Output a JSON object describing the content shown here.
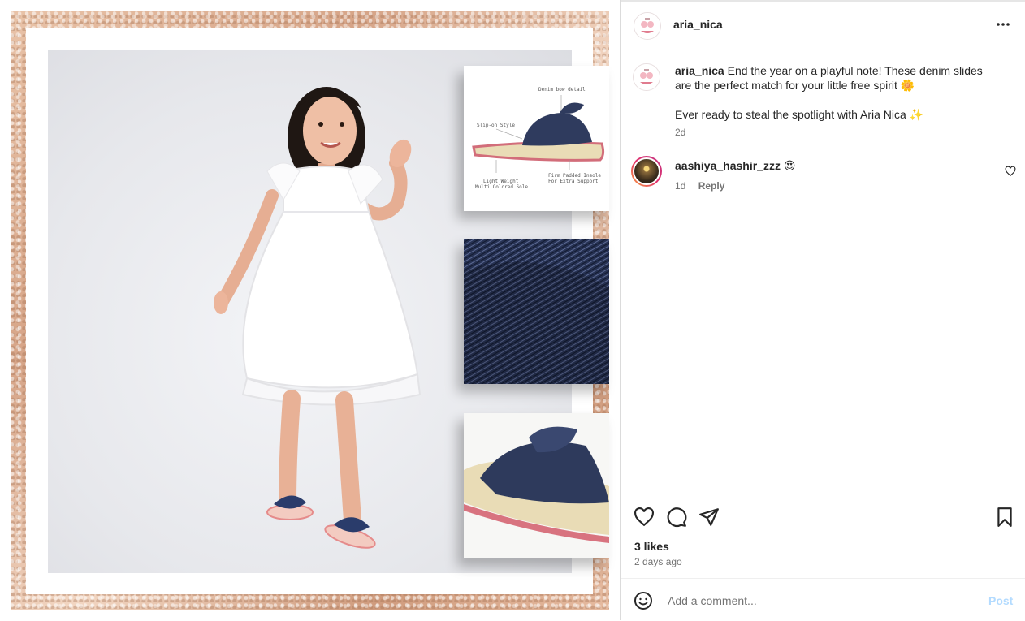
{
  "post": {
    "author": "aria_nica",
    "more_options": "...",
    "caption": {
      "username": "aria_nica",
      "text": " End the year on a playful note! These denim slides are the perfect match for your little free spirit 🌼",
      "line2": "Ever ready to steal the spotlight with Aria Nica ✨",
      "time": "2d"
    },
    "comments": [
      {
        "username": "aashiya_hashir_zzz",
        "text": "😍",
        "time": "1d",
        "reply_label": "Reply"
      }
    ],
    "likes": "3 likes",
    "date": "2 days ago",
    "add_comment_placeholder": "Add a comment...",
    "post_label": "Post"
  },
  "image": {
    "callouts": {
      "bow": "Denim bow detail",
      "slip": "Slip-on Style",
      "sole_1": "Light Weight",
      "sole_2": "Multi Colored Sole",
      "insole_1": "Firm Padded Insole",
      "insole_2": "For Extra Support"
    }
  },
  "icons": {
    "more": "more-horizontal-icon",
    "like": "heart-icon",
    "comment": "comment-bubble-icon",
    "share": "paper-plane-icon",
    "save": "bookmark-icon",
    "emoji": "smiley-icon"
  },
  "colors": {
    "text": "#262626",
    "secondary": "#737373",
    "post_button_disabled": "#b3dbff",
    "story_ring": "#e1306c"
  }
}
